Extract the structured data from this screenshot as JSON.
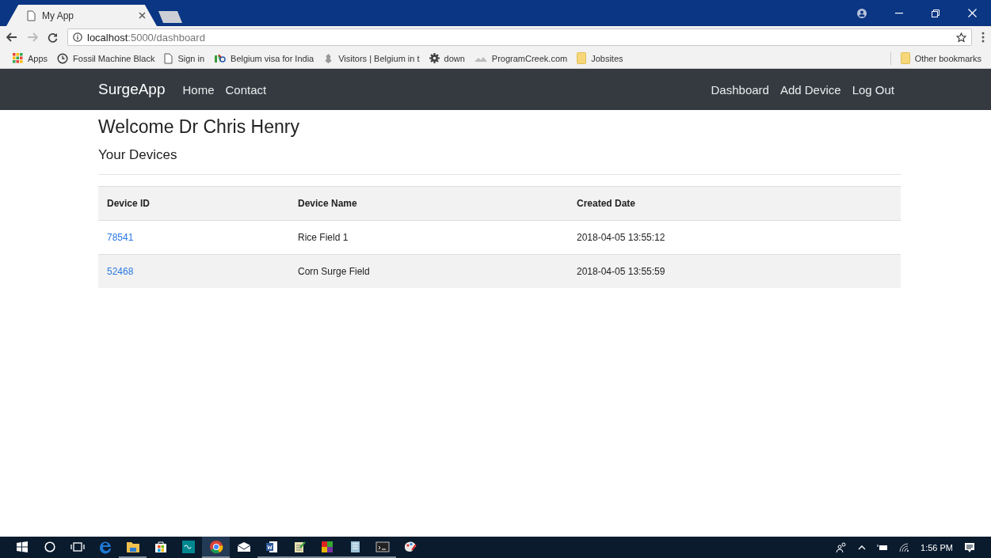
{
  "browser": {
    "tabs": [
      {
        "title": "My App",
        "selected": true,
        "kind": "page"
      },
      {
        "selected": false,
        "kind": "new"
      }
    ],
    "address": {
      "host": "localhost",
      "path": ":5000/dashboard"
    },
    "bookmarks": [
      {
        "label": "Apps",
        "kind": "apps"
      },
      {
        "label": "Fossil Machine Black",
        "kind": "clock"
      },
      {
        "label": "Sign in",
        "kind": "page"
      },
      {
        "label": "Belgium visa for India",
        "kind": "logo"
      },
      {
        "label": "Visitors | Belgium in t",
        "kind": "emblem"
      },
      {
        "label": "down",
        "kind": "gear"
      },
      {
        "label": "ProgramCreek.com",
        "kind": "image"
      },
      {
        "label": "Jobsites",
        "kind": "folder"
      }
    ],
    "other_bookmarks": "Other bookmarks"
  },
  "navbar": {
    "brand": "SurgeApp",
    "left": [
      "Home",
      "Contact"
    ],
    "right": [
      "Dashboard",
      "Add Device",
      "Log Out"
    ]
  },
  "heading": "Welcome Dr Chris Henry",
  "subheading": "Your Devices",
  "table": {
    "columns": [
      "Device ID",
      "Device Name",
      "Created Date"
    ],
    "rows": [
      [
        "78541",
        "Rice Field 1",
        "2018-04-05 13:55:12"
      ],
      [
        "52468",
        "Corn Surge Field",
        "2018-04-05 13:55:59"
      ]
    ]
  },
  "taskbar": {
    "apps": [
      {
        "kind": "edge",
        "selected": false,
        "running": false
      },
      {
        "kind": "folder",
        "selected": false,
        "running": true
      },
      {
        "kind": "store",
        "selected": false,
        "running": false
      },
      {
        "kind": "arduino",
        "selected": false,
        "running": false
      },
      {
        "kind": "chrome",
        "selected": true,
        "running": true
      },
      {
        "kind": "mail",
        "selected": false,
        "running": false
      },
      {
        "kind": "word",
        "selected": false,
        "running": true
      },
      {
        "kind": "notepad",
        "selected": false,
        "running": true
      },
      {
        "kind": "tiles",
        "selected": false,
        "running": true
      },
      {
        "kind": "notes",
        "selected": false,
        "running": true
      },
      {
        "kind": "console",
        "selected": false,
        "running": true
      },
      {
        "kind": "paint",
        "selected": false,
        "running": false
      }
    ],
    "time": "1:56 PM"
  }
}
